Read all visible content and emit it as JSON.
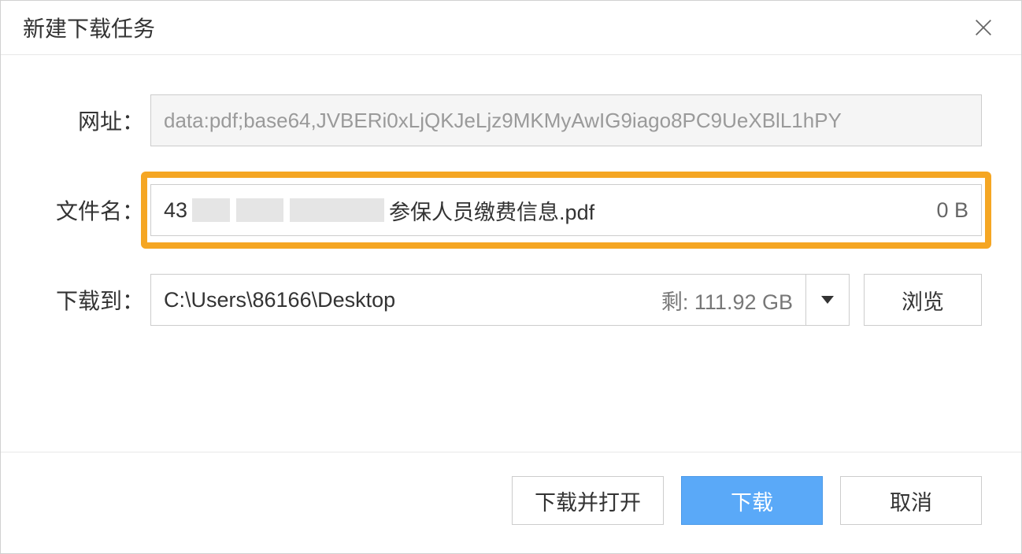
{
  "titlebar": {
    "title": "新建下载任务"
  },
  "form": {
    "url_label": "网址：",
    "url_value": "data:pdf;base64,JVBERi0xLjQKJeLjz9MKMyAwIG9iago8PC9UeXBlL1hPY",
    "filename_label": "文件名：",
    "filename_prefix": "43",
    "filename_suffix": "参保人员缴费信息.pdf",
    "filesize": "0 B",
    "path_label": "下载到：",
    "path_value": "C:\\Users\\86166\\Desktop",
    "path_remain": "剩: 111.92 GB",
    "browse_label": "浏览"
  },
  "footer": {
    "download_open": "下载并打开",
    "download": "下载",
    "cancel": "取消"
  }
}
